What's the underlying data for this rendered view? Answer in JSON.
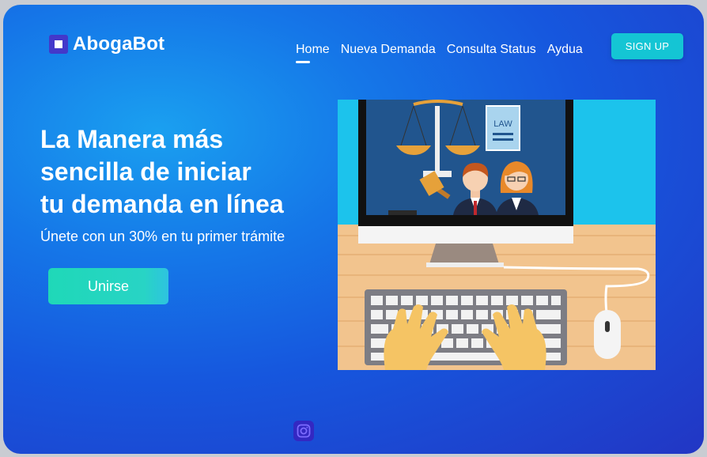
{
  "brand": {
    "name": "AbogaBot",
    "logo_icon": "square-logo-icon"
  },
  "nav": {
    "items": [
      {
        "label": "Home",
        "active": true
      },
      {
        "label": "Nueva Demanda",
        "active": false
      },
      {
        "label": "Consulta Status",
        "active": false
      },
      {
        "label": "Aydua",
        "active": false
      }
    ],
    "signup_label": "SIGN UP"
  },
  "hero": {
    "title_lines": [
      "La Manera más",
      "sencilla de iniciar",
      "tu demanda en línea"
    ],
    "subtitle": "Únete con un 30% en tu primer trámite",
    "cta_label": "Unirse"
  },
  "illustration": {
    "badge_text": "LAW"
  },
  "footer": {
    "social_icon": "instagram-icon"
  },
  "colors": {
    "accent_teal": "#14c5d4",
    "cta_green": "#1fd8b8",
    "bg_blue": "#1657de",
    "logo_purple": "#4338ca"
  }
}
